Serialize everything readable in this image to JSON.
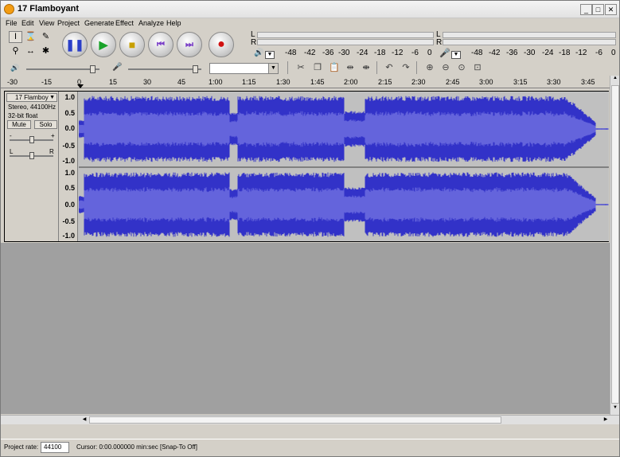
{
  "window": {
    "title": "17 Flamboyant"
  },
  "menu": [
    "File",
    "Edit",
    "View",
    "Project",
    "Generate",
    "Effect",
    "Analyze",
    "Help"
  ],
  "meters": {
    "left_label": "L",
    "right_label": "R",
    "playback_scale": [
      "-48",
      "-42",
      "-36",
      "-30",
      "-24",
      "-18",
      "-12",
      "-6",
      "0"
    ],
    "record_scale": [
      "-48",
      "-42",
      "-36",
      "-30",
      "-24",
      "-18",
      "-12",
      "-6",
      "0"
    ]
  },
  "ruler": [
    "-30",
    "-15",
    "0",
    "15",
    "30",
    "45",
    "1:00",
    "1:15",
    "1:30",
    "1:45",
    "2:00",
    "2:15",
    "2:30",
    "2:45",
    "3:00",
    "3:15",
    "3:30",
    "3:45"
  ],
  "track": {
    "name": "17 Flamboy",
    "info_rate": "Stereo, 44100Hz",
    "info_format": "32-bit float",
    "mute_label": "Mute",
    "solo_label": "Solo",
    "gain_minus": "-",
    "gain_plus": "+",
    "pan_left": "L",
    "pan_right": "R",
    "scale": [
      "1.0",
      "0.5",
      "0.0",
      "-0.5",
      "-1.0"
    ]
  },
  "status": {
    "project_rate_label": "Project rate:",
    "project_rate_value": "44100",
    "cursor": "Cursor: 0:00.000000 min:sec",
    "snap": "[Snap-To Off]"
  },
  "colors": {
    "wave_dark": "#3232c8",
    "wave_light": "#6464dc",
    "background_grey": "#a0a0a0"
  }
}
